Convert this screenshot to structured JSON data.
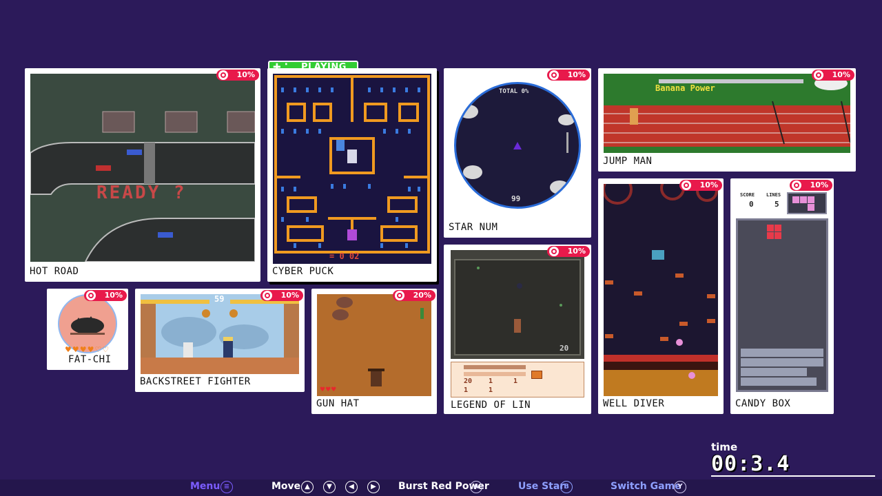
{
  "playing_label": "PLAYING",
  "games": [
    {
      "id": "hot-road",
      "title": "HOT ROAD",
      "percent": "10%",
      "overlay": "READY ?"
    },
    {
      "id": "cyber-puck",
      "title": "CYBER PUCK",
      "percent": "",
      "hud": "= 0  02"
    },
    {
      "id": "star-num",
      "title": "STAR NUM",
      "percent": "10%",
      "hud_top": "TOTAL 0%",
      "hud_bottom": "99"
    },
    {
      "id": "jump-man",
      "title": "JUMP MAN",
      "percent": "10%",
      "overlay": "Banana Power"
    },
    {
      "id": "fat-chi",
      "title": "FAT-CHI",
      "percent": "10%"
    },
    {
      "id": "backstreet-fighter",
      "title": "BACKSTREET FIGHTER",
      "percent": "10%",
      "timer": "59"
    },
    {
      "id": "gun-hat",
      "title": "GUN HAT",
      "percent": "20%"
    },
    {
      "id": "legend-of-lin",
      "title": "LEGEND OF LIN",
      "percent": "10%",
      "hud_a": "20",
      "hud_b": "1",
      "hud_c": "1",
      "hud_d": "1",
      "hud_e": "1",
      "level": "20"
    },
    {
      "id": "well-diver",
      "title": "WELL DIVER",
      "percent": "10%"
    },
    {
      "id": "candy-box",
      "title": "CANDY BOX",
      "percent": "10%",
      "score_label": "SCORE",
      "score": "0",
      "lines_label": "LINES",
      "lines": "5"
    }
  ],
  "time": {
    "label": "time",
    "value": "00:3.4"
  },
  "controls": [
    {
      "label": "Menu",
      "icon": "menu-icon",
      "glyph": "≡"
    },
    {
      "label": "Move",
      "icons": [
        {
          "name": "up-icon",
          "glyph": "▲"
        },
        {
          "name": "down-icon",
          "glyph": "▼"
        },
        {
          "name": "left-icon",
          "glyph": "◀"
        },
        {
          "name": "right-icon",
          "glyph": "▶"
        }
      ]
    },
    {
      "label": "Burst Red Power",
      "icon": "a-button-icon",
      "glyph": "A"
    },
    {
      "label": "Use Star",
      "icon": "b-button-icon",
      "glyph": "B"
    },
    {
      "label": "Switch Game",
      "icon": "y-button-icon",
      "glyph": "Y"
    }
  ],
  "colors": {
    "background": "#2c1a5a",
    "badge": "#e8194b",
    "playing": "#33cc33",
    "menu": "#7b5cff",
    "hint_blue": "#8ea0ff"
  }
}
